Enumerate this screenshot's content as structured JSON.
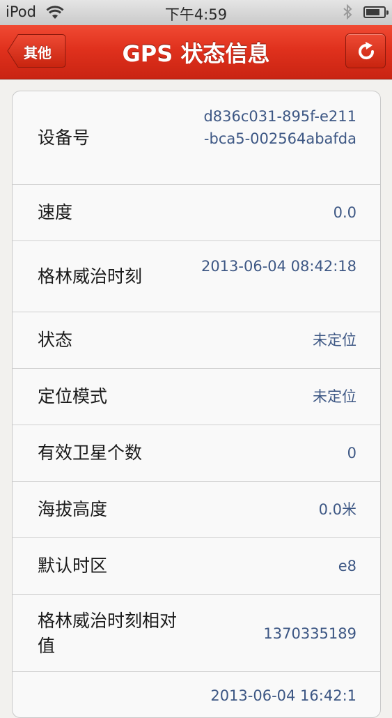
{
  "status_bar": {
    "carrier": "iPod",
    "time": "下午4:59",
    "wifi_icon": "wifi-icon",
    "bluetooth_icon": "bluetooth-icon",
    "battery_icon": "battery-icon",
    "battery_level": 0.8
  },
  "nav": {
    "title": "GPS 状态信息",
    "back_label": "其他",
    "refresh_icon": "refresh-icon"
  },
  "rows": [
    {
      "key": "设备号",
      "value": "d836c031-895f-e211-bca5-002564abafda"
    },
    {
      "key": "速度",
      "value": "0.0"
    },
    {
      "key": "格林威治时刻",
      "value": "2013-06-04 08:42:18"
    },
    {
      "key": "状态",
      "value": "未定位"
    },
    {
      "key": "定位模式",
      "value": "未定位"
    },
    {
      "key": "有效卫星个数",
      "value": "0"
    },
    {
      "key": "海拔高度",
      "value": "0.0米"
    },
    {
      "key": "默认时区",
      "value": "e8"
    },
    {
      "key": "格林威治时刻相对值",
      "value": "1370335189"
    },
    {
      "key": "",
      "value": "2013-06-04 16:42:1"
    }
  ],
  "colors": {
    "nav_red": "#e0311d",
    "value_text": "#3d5784"
  }
}
